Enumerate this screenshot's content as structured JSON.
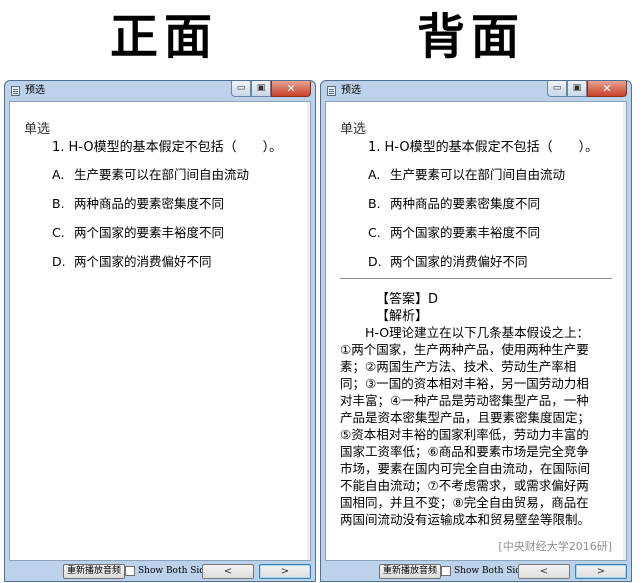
{
  "headings": {
    "front": "正面",
    "back": "背面"
  },
  "window": {
    "title": "预选",
    "controls": {
      "min": "▭",
      "max": "▣",
      "close": "✕"
    }
  },
  "question": {
    "type": "单选",
    "stem": "1. H-O模型的基本假定不包括（　　）。",
    "options": [
      {
        "letter": "A.",
        "text": "生产要素可以在部门间自由流动"
      },
      {
        "letter": "B.",
        "text": "两种商品的要素密集度不同"
      },
      {
        "letter": "C.",
        "text": "两个国家的要素丰裕度不同"
      },
      {
        "letter": "D.",
        "text": "两个国家的消费偏好不同"
      }
    ]
  },
  "answer": {
    "answer_line": "【答案】D",
    "analysis_label": "【解析】",
    "analysis_lines": [
      "　　H-O理论建立在以下几条基本假设之上：",
      "①两个国家，生产两种产品，使用两种生产要",
      "素；②两国生产方法、技术、劳动生产率相",
      "同；③一国的资本相对丰裕，另一国劳动力相",
      "对丰富；④一种产品是劳动密集型产品，一种",
      "产品是资本密集型产品，且要素密集度固定；",
      "⑤资本相对丰裕的国家利率低，劳动力丰富的",
      "国家工资率低；⑥商品和要素市场是完全竞争",
      "市场，要素在国内可完全自由流动，在国际间",
      "不能自由流动；⑦不考虑需求，或需求偏好两",
      "国相同，并且不变；⑧完全自由贸易，商品在",
      "两国间流动没有运输成本和贸易壁垒等限制。"
    ],
    "source": "[中央财经大学2016研]"
  },
  "bottom": {
    "replay_label": "重新播放音频",
    "show_both_label": "Show Both Sides",
    "prev_label": "<",
    "next_label": ">"
  }
}
